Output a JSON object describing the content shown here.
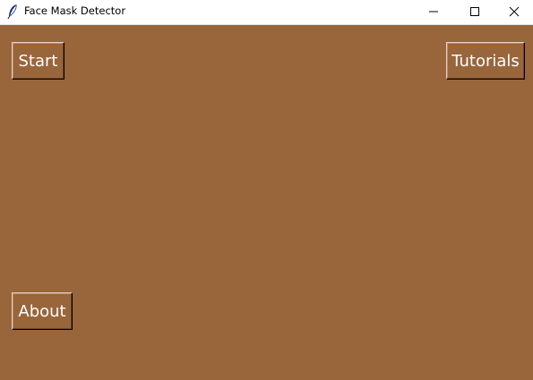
{
  "window": {
    "title": "Face Mask Detector",
    "app_icon": "feather-icon",
    "controls": {
      "minimize_icon": "minimize-icon",
      "maximize_icon": "maximize-icon",
      "close_icon": "close-icon"
    }
  },
  "main": {
    "background_color": "#99653b",
    "buttons": {
      "start": "Start",
      "tutorials": "Tutorials",
      "about": "About"
    }
  }
}
